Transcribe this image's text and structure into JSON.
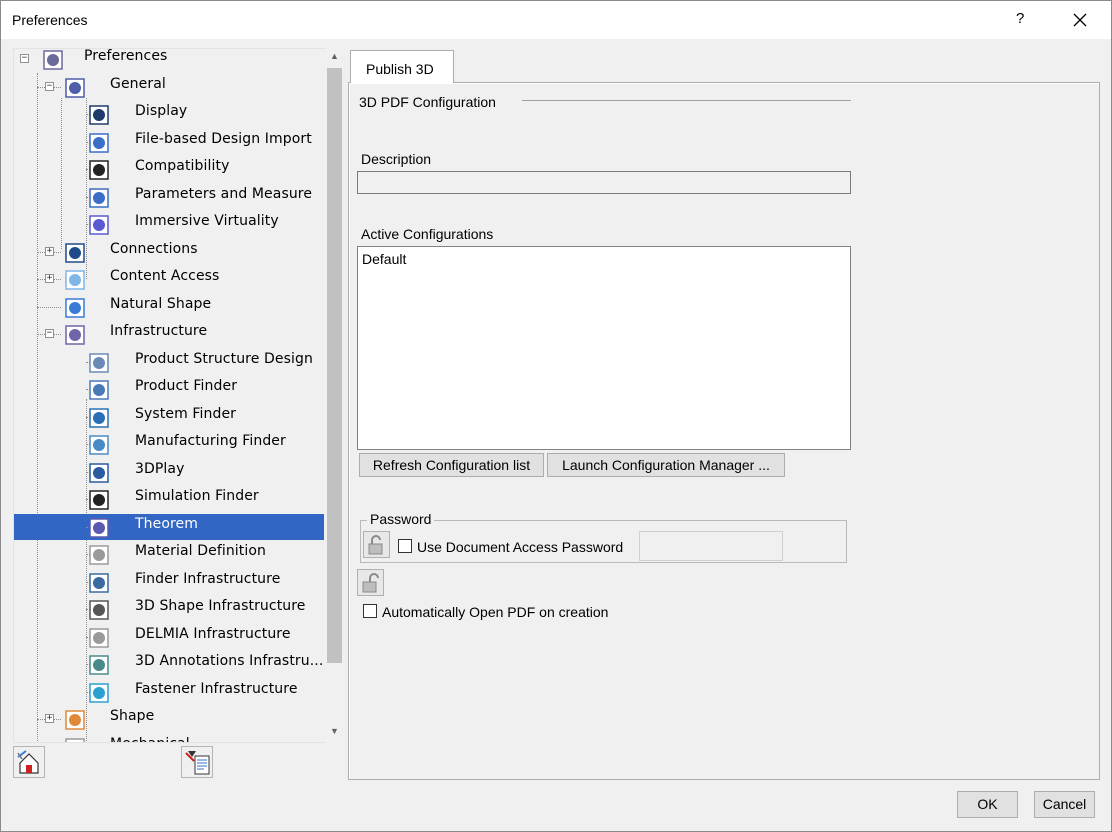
{
  "window": {
    "title": "Preferences",
    "help": "?",
    "close": "✕"
  },
  "tree": {
    "items": [
      {
        "label": "Preferences",
        "icon": "preferences-root-icon",
        "level": 0,
        "expander": "−"
      },
      {
        "label": "General",
        "icon": "general-icon",
        "level": 1,
        "expander": "−"
      },
      {
        "label": "Display",
        "icon": "display-icon",
        "level": 2
      },
      {
        "label": "File-based Design Import",
        "icon": "file-import-icon",
        "level": 2
      },
      {
        "label": "Compatibility",
        "icon": "compatibility-icon",
        "level": 2
      },
      {
        "label": "Parameters and Measure",
        "icon": "parameters-icon",
        "level": 2
      },
      {
        "label": "Immersive Virtuality",
        "icon": "immersive-icon",
        "level": 2
      },
      {
        "label": "Connections",
        "icon": "connections-icon",
        "level": 1,
        "expander": "+"
      },
      {
        "label": "Content Access",
        "icon": "content-access-icon",
        "level": 1,
        "expander": "+"
      },
      {
        "label": "Natural Shape",
        "icon": "natural-shape-icon",
        "level": 1
      },
      {
        "label": "Infrastructure",
        "icon": "infrastructure-icon",
        "level": 1,
        "expander": "−"
      },
      {
        "label": "Product Structure Design",
        "icon": "product-structure-icon",
        "level": 2
      },
      {
        "label": "Product Finder",
        "icon": "product-finder-icon",
        "level": 2
      },
      {
        "label": "System Finder",
        "icon": "system-finder-icon",
        "level": 2
      },
      {
        "label": "Manufacturing Finder",
        "icon": "manufacturing-finder-icon",
        "level": 2
      },
      {
        "label": "3DPlay",
        "icon": "3dplay-icon",
        "level": 2
      },
      {
        "label": "Simulation Finder",
        "icon": "simulation-finder-icon",
        "level": 2
      },
      {
        "label": "Theorem",
        "icon": "theorem-icon",
        "level": 2,
        "selected": true
      },
      {
        "label": "Material Definition",
        "icon": "material-definition-icon",
        "level": 2
      },
      {
        "label": "Finder Infrastructure",
        "icon": "finder-infrastructure-icon",
        "level": 2
      },
      {
        "label": "3D Shape Infrastructure",
        "icon": "3d-shape-infrastructure-icon",
        "level": 2
      },
      {
        "label": "DELMIA Infrastructure",
        "icon": "delmia-infrastructure-icon",
        "level": 2
      },
      {
        "label": "3D Annotations Infrastru...",
        "icon": "3d-annotations-icon",
        "level": 2
      },
      {
        "label": "Fastener Infrastructure",
        "icon": "fastener-infrastructure-icon",
        "level": 2
      },
      {
        "label": "Shape",
        "icon": "shape-icon",
        "level": 1,
        "expander": "+"
      },
      {
        "label": "Mechanical",
        "icon": "mechanical-icon",
        "level": 1
      }
    ],
    "scroll_up": "▲",
    "scroll_down": "▼"
  },
  "tabs": [
    {
      "label": "Publish 3D",
      "active": true
    }
  ],
  "publish3d": {
    "section_title": "3D PDF Configuration",
    "description_label": "Description",
    "description_value": "",
    "active_configs_label": "Active Configurations",
    "configurations": [
      "Default"
    ],
    "refresh_button": "Refresh Configuration list",
    "launch_button": "Launch Configuration Manager ...",
    "password_group": "Password",
    "use_password_label": "Use Document Access Password",
    "use_password_checked": false,
    "password_value": "",
    "auto_open_label": "Automatically Open PDF on creation",
    "auto_open_checked": false
  },
  "footer": {
    "ok": "OK",
    "cancel": "Cancel"
  },
  "colors": {
    "selection": "#3266c4",
    "window_bg": "#f0f0f0"
  }
}
